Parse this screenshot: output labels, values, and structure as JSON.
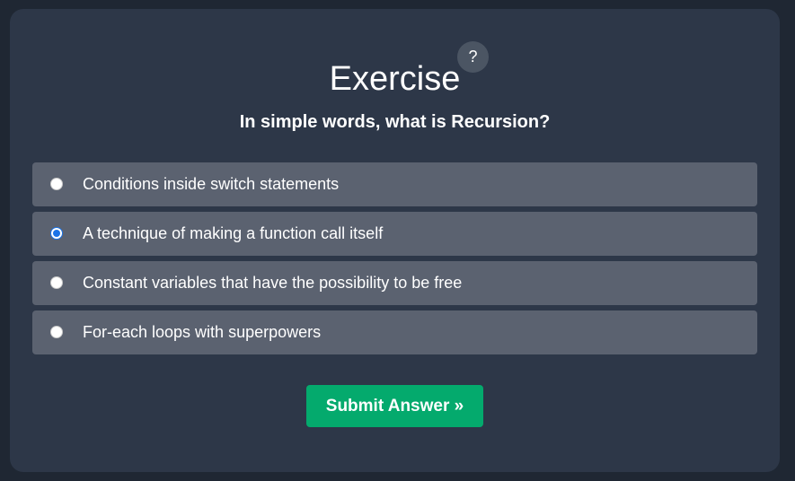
{
  "exercise": {
    "title": "Exercise",
    "help_label": "?",
    "question": "In simple words, what is Recursion?",
    "options": [
      {
        "label": "Conditions inside switch statements",
        "selected": false
      },
      {
        "label": "A technique of making a function call itself",
        "selected": true
      },
      {
        "label": "Constant variables that have the possibility to be free",
        "selected": false
      },
      {
        "label": "For-each loops with superpowers",
        "selected": false
      }
    ],
    "submit_label": "Submit Answer »"
  },
  "colors": {
    "page_background": "#1f2733",
    "card_background": "#2d3748",
    "option_background": "#5b6270",
    "submit_background": "#04aa6d",
    "radio_selected": "#1a73e8"
  }
}
